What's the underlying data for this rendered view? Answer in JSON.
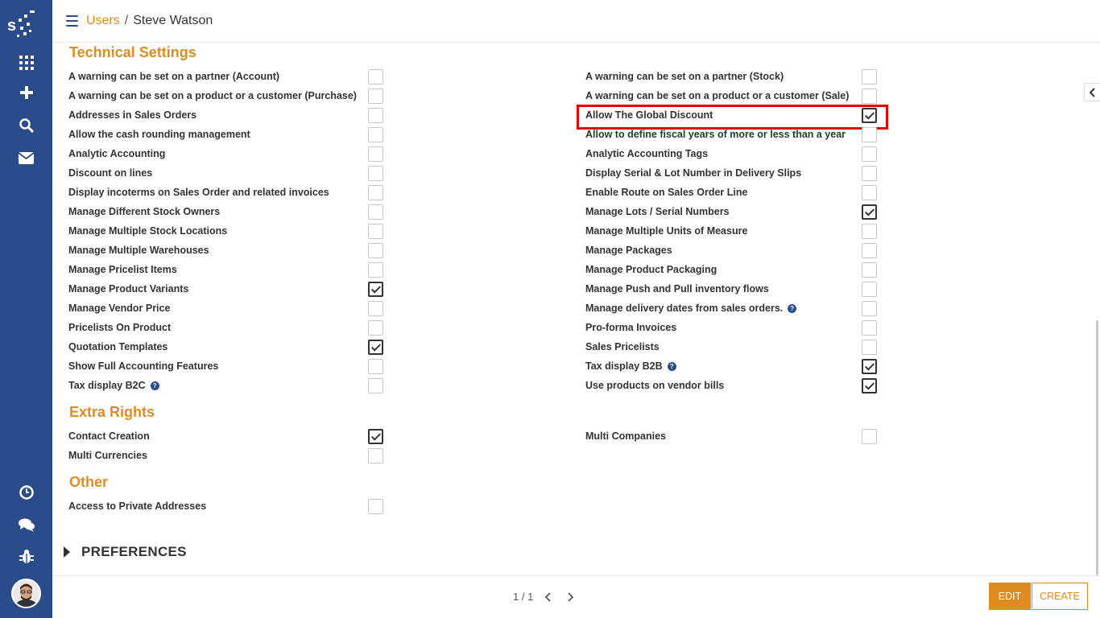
{
  "breadcrumb": {
    "parent": "Users",
    "separator": "/",
    "current": "Steve Watson"
  },
  "sections": {
    "technical": {
      "title": "Technical Settings",
      "left": [
        {
          "label": "A warning can be set on a partner (Account)",
          "checked": false
        },
        {
          "label": "A warning can be set on a product or a customer (Purchase)",
          "checked": false
        },
        {
          "label": "Addresses in Sales Orders",
          "checked": false
        },
        {
          "label": "Allow the cash rounding management",
          "checked": false
        },
        {
          "label": "Analytic Accounting",
          "checked": false
        },
        {
          "label": "Discount on lines",
          "checked": false
        },
        {
          "label": "Display incoterms on Sales Order and related invoices",
          "checked": false
        },
        {
          "label": "Manage Different Stock Owners",
          "checked": false
        },
        {
          "label": "Manage Multiple Stock Locations",
          "checked": false
        },
        {
          "label": "Manage Multiple Warehouses",
          "checked": false
        },
        {
          "label": "Manage Pricelist Items",
          "checked": false
        },
        {
          "label": "Manage Product Variants",
          "checked": true
        },
        {
          "label": "Manage Vendor Price",
          "checked": false
        },
        {
          "label": "Pricelists On Product",
          "checked": false
        },
        {
          "label": "Quotation Templates",
          "checked": true
        },
        {
          "label": "Show Full Accounting Features",
          "checked": false
        },
        {
          "label": "Tax display B2C",
          "checked": false,
          "help": "?"
        }
      ],
      "right": [
        {
          "label": "A warning can be set on a partner (Stock)",
          "checked": false
        },
        {
          "label": "A warning can be set on a product or a customer (Sale)",
          "checked": false
        },
        {
          "label": "Allow The Global Discount",
          "checked": true
        },
        {
          "label": "Allow to define fiscal years of more or less than a year",
          "checked": false
        },
        {
          "label": "Analytic Accounting Tags",
          "checked": false
        },
        {
          "label": "Display Serial & Lot Number in Delivery Slips",
          "checked": false
        },
        {
          "label": "Enable Route on Sales Order Line",
          "checked": false
        },
        {
          "label": "Manage Lots / Serial Numbers",
          "checked": true
        },
        {
          "label": "Manage Multiple Units of Measure",
          "checked": false
        },
        {
          "label": "Manage Packages",
          "checked": false
        },
        {
          "label": "Manage Product Packaging",
          "checked": false
        },
        {
          "label": "Manage Push and Pull inventory flows",
          "checked": false
        },
        {
          "label": "Manage delivery dates from sales orders.",
          "checked": false,
          "help": "?"
        },
        {
          "label": "Pro-forma Invoices",
          "checked": false
        },
        {
          "label": "Sales Pricelists",
          "checked": false
        },
        {
          "label": "Tax display B2B",
          "checked": true,
          "help": "?"
        },
        {
          "label": "Use products on vendor bills",
          "checked": true
        }
      ]
    },
    "extra": {
      "title": "Extra Rights",
      "left": [
        {
          "label": "Contact Creation",
          "checked": true
        },
        {
          "label": "Multi Currencies",
          "checked": false
        }
      ],
      "right": [
        {
          "label": "Multi Companies",
          "checked": false
        }
      ]
    },
    "other": {
      "title": "Other",
      "left": [
        {
          "label": "Access to Private Addresses",
          "checked": false
        }
      ]
    }
  },
  "preferences": {
    "label": "PREFERENCES"
  },
  "pager": {
    "text": "1 / 1"
  },
  "buttons": {
    "edit": "EDIT",
    "create": "CREATE"
  },
  "colors": {
    "sidebar": "#2a4c8a",
    "accent": "#e08b1f",
    "highlight": "#e00000"
  },
  "icons": [
    "logo",
    "apps-grid-icon",
    "plus-icon",
    "search-icon",
    "mail-icon",
    "clock-icon",
    "chat-icon",
    "bug-icon",
    "hamburger-icon",
    "chevron-left-icon",
    "chevron-right-icon",
    "question-icon"
  ]
}
